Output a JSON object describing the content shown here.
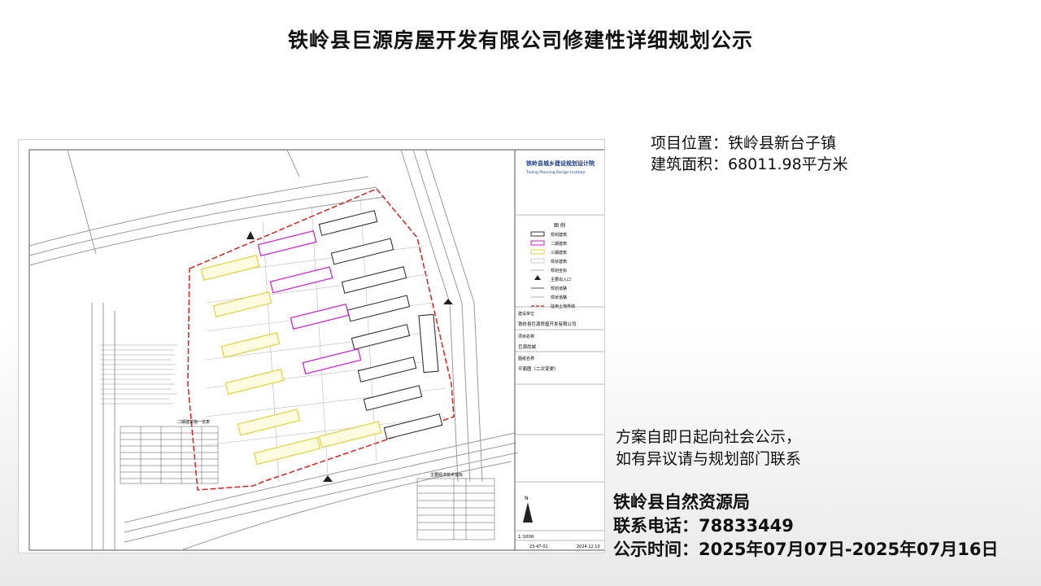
{
  "title": "铁岭县巨源房屋开发有限公司修建性详细规划公示",
  "project": {
    "location": "项目位置：铁岭县新台子镇",
    "area": "建筑面积：68011.98平方米"
  },
  "notice": {
    "line1": "方案自即日起向社会公示，",
    "line2": "如有异议请与规划部门联系"
  },
  "footer": {
    "agency": "铁岭县自然资源局",
    "phone": "联系电话：78833449",
    "period": "公示时间：2025年07月07日-2025年07月16日"
  },
  "drawing": {
    "institute_cn": "铁岭县城乡建设规划设计院",
    "institute_en": "Tieling Planning Design Institute",
    "legend_title": "图 例",
    "legend": [
      "规划建筑",
      "二期建筑",
      "三期建筑",
      "现状建筑",
      "规划坐标",
      "主要出入口",
      "规划道路",
      "现状道路",
      "征用土地界线"
    ],
    "client_label": "建设单位",
    "client": "铁岭县巨源房屋开发有限公司",
    "project_label": "项目名称",
    "project_name": "巨源尚城",
    "drawing_label": "图纸名称",
    "drawing_name": "平面图（二次变更）",
    "scale": "1:1000",
    "drawing_no": "23-47-01",
    "date": "2024.12.10",
    "stats_title": "主要经济技术指标",
    "phase2_title": "二期建筑物一览表",
    "north": "N",
    "colors": {
      "planned": "#333333",
      "phase2": "#d21bd2",
      "phase3": "#e3d23a",
      "boundary": "#e02020",
      "road": "#8a8a8a"
    }
  }
}
